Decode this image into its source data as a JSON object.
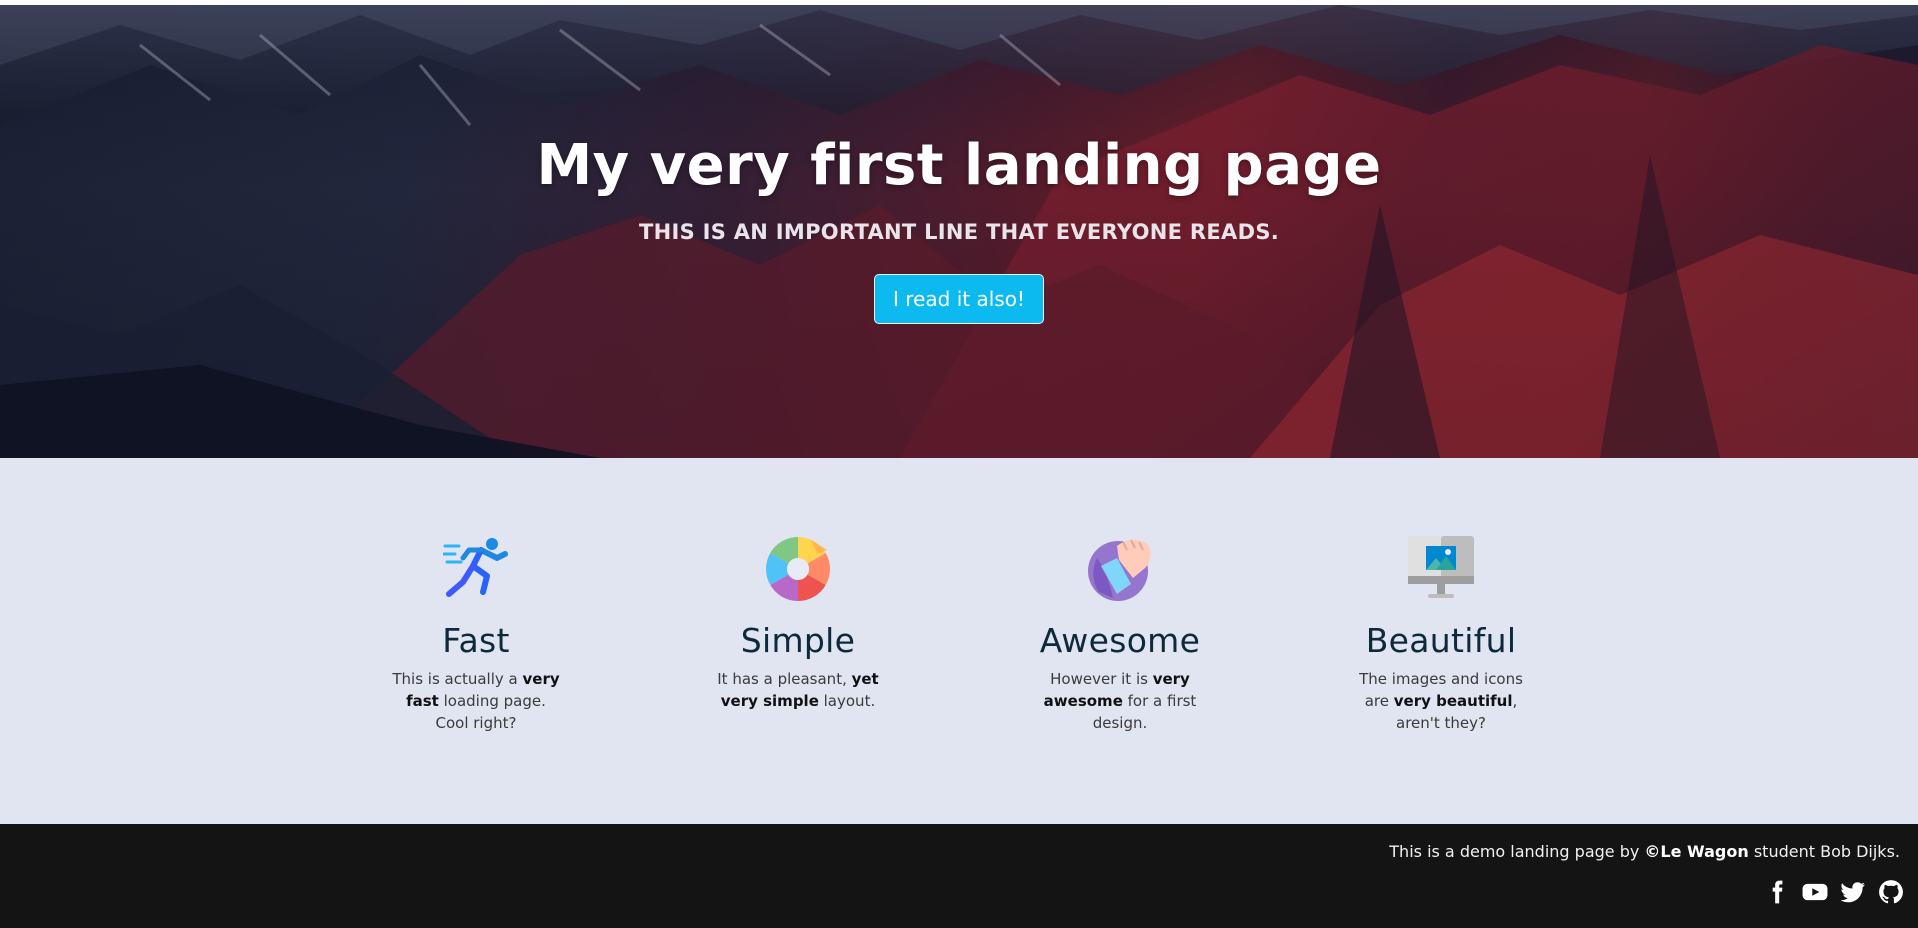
{
  "hero": {
    "title": "My very first landing page",
    "subtitle": "THIS IS AN IMPORTANT LINE THAT EVERYONE READS.",
    "button_label": "I read it also!",
    "button_color": "#0dbaf0"
  },
  "features": [
    {
      "icon": "runner-icon",
      "title": "Fast",
      "text_before": "This is actually a ",
      "text_bold": "very fast",
      "text_after": " loading page. Cool right?"
    },
    {
      "icon": "color-wheel-icon",
      "title": "Simple",
      "text_before": "It has a pleasant, ",
      "text_bold": "yet very simple",
      "text_after": " layout."
    },
    {
      "icon": "fist-icon",
      "title": "Awesome",
      "text_before": "However it is ",
      "text_bold": "very awesome",
      "text_after": " for a first design."
    },
    {
      "icon": "monitor-icon",
      "title": "Beautiful",
      "text_before": "The images and icons are ",
      "text_bold": "very beautiful",
      "text_after": ", aren't they?"
    }
  ],
  "footer": {
    "text_before": "This is a demo landing page by ",
    "text_bold": "©Le Wagon",
    "text_after": " student Bob Dijks.",
    "social": [
      "facebook-icon",
      "youtube-icon",
      "twitter-icon",
      "github-icon"
    ]
  },
  "colors": {
    "features_bg": "#e1e4f1",
    "footer_bg": "#141414",
    "feature_title": "#0d2a3c"
  }
}
